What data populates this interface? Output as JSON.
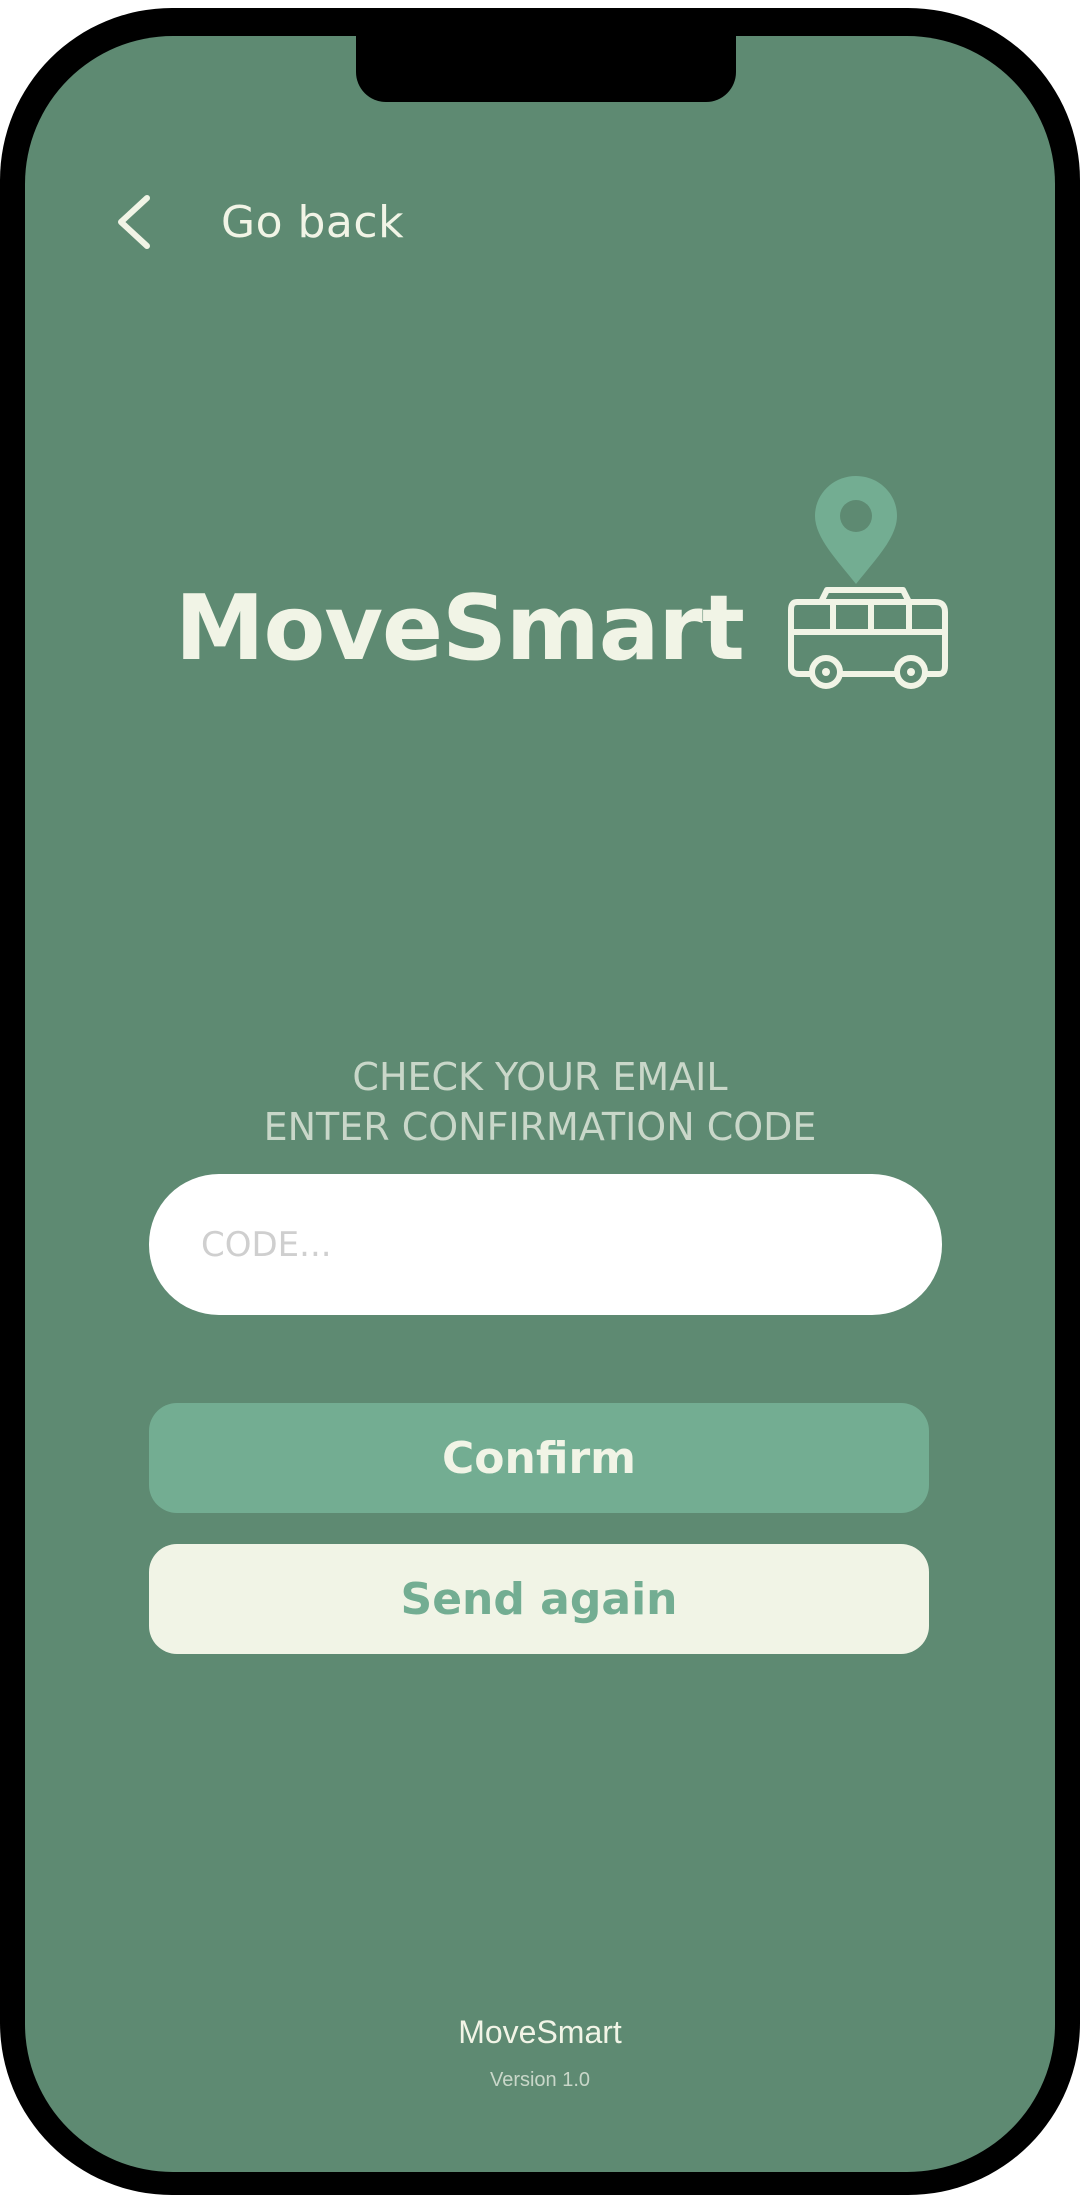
{
  "header": {
    "back_label": "Go back",
    "back_icon": "chevron-left-icon"
  },
  "logo": {
    "text": "MoveSmart",
    "icon": "bus-with-location-pin-icon"
  },
  "instructions": {
    "line1": "CHECK YOUR EMAIL",
    "line2": "ENTER CONFIRMATION CODE"
  },
  "code_input": {
    "placeholder": "CODE...",
    "value": ""
  },
  "buttons": {
    "confirm_label": "Confirm",
    "send_again_label": "Send again"
  },
  "footer": {
    "app_name": "MoveSmart",
    "version": "Version 1.0"
  },
  "colors": {
    "background": "#5e8a72",
    "cream": "#f1f4e6",
    "accent": "#73ad92",
    "frame": "#000000"
  }
}
